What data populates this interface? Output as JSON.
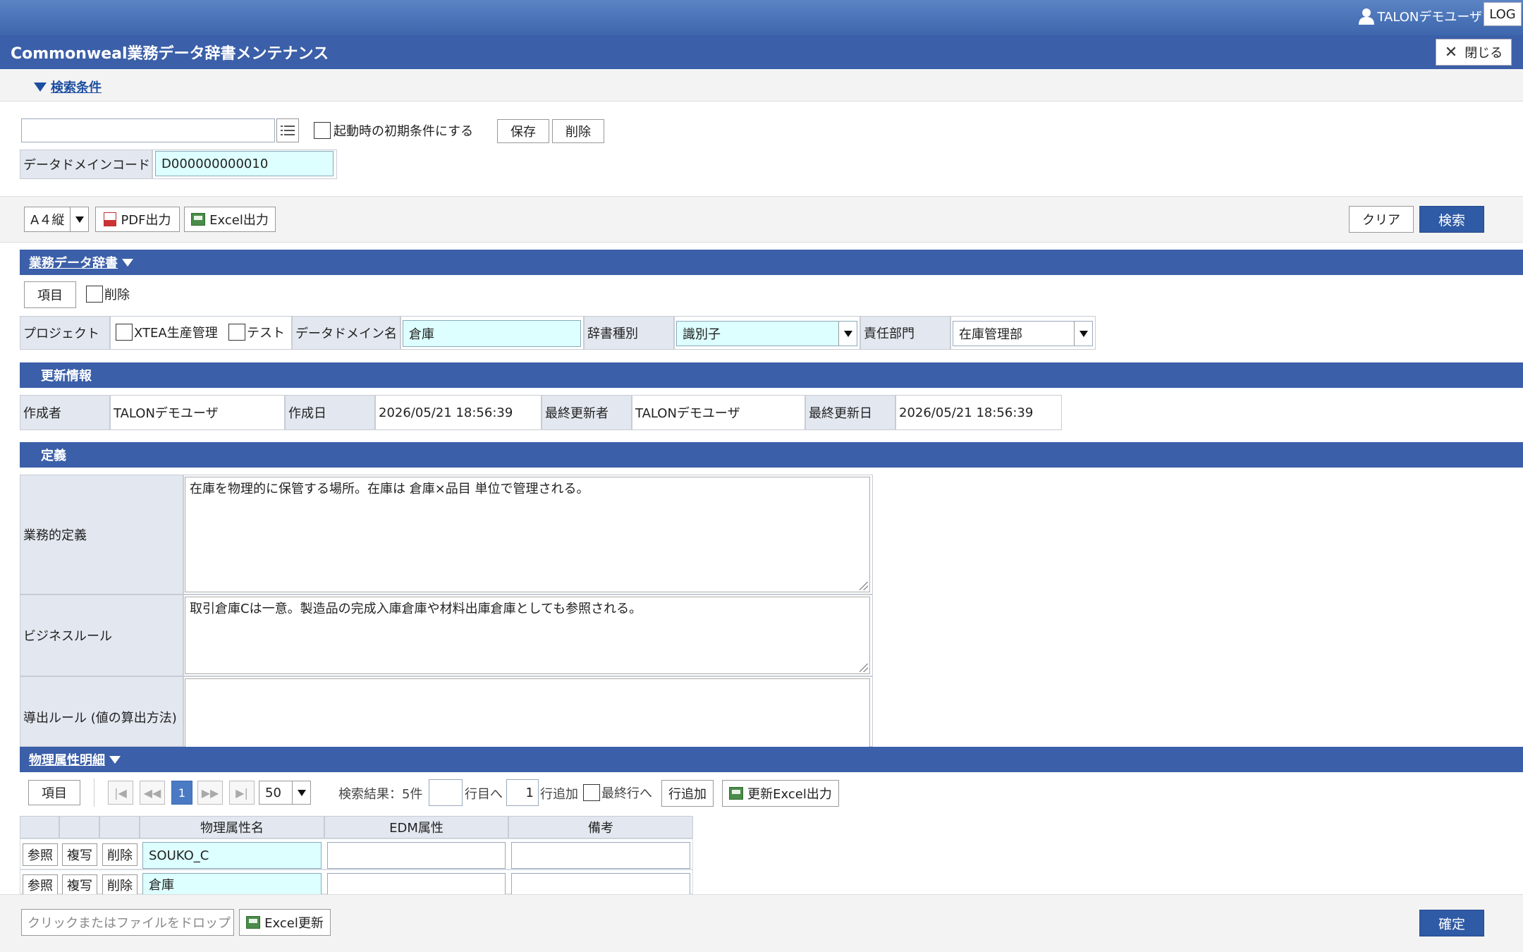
{
  "header": {
    "user": "TALONデモユーザ",
    "log_button": "LOG"
  },
  "title": "Commonweal業務データ辞書メンテナンス",
  "close_button": "閉じる",
  "search": {
    "toggle_label": "検索条件",
    "condition_name_value": "",
    "initial_condition_label": "起動時の初期条件にする",
    "save_button": "保存",
    "delete_button": "削除",
    "domain_code_label": "データドメインコード",
    "domain_code_value": "D000000000010"
  },
  "toolbar": {
    "paper_size": "A４縦",
    "pdf_button": "PDF出力",
    "excel_button": "Excel出力",
    "clear_button": "クリア",
    "search_button": "検索"
  },
  "dictionary": {
    "section_title": "業務データ辞書",
    "items_button": "項目",
    "delete_check_label": "削除",
    "project_label": "プロジェクト",
    "project_options": [
      "XTEA生産管理",
      "テスト"
    ],
    "domain_name_label": "データドメイン名",
    "domain_name_value": "倉庫",
    "dict_type_label": "辞書種別",
    "dict_type_value": "識別子",
    "dept_label": "責任部門",
    "dept_value": "在庫管理部"
  },
  "update_info": {
    "section_title": "更新情報",
    "creator_label": "作成者",
    "creator_value": "TALONデモユーザ",
    "created_label": "作成日",
    "created_value": "2026/05/21 18:56:39",
    "updater_label": "最終更新者",
    "updater_value": "TALONデモユーザ",
    "updated_label": "最終更新日",
    "updated_value": "2026/05/21 18:56:39"
  },
  "definition": {
    "section_title": "定義",
    "business_def_label": "業務的定義",
    "business_def_value": "在庫を物理的に保管する場所。在庫は 倉庫×品目 単位で管理される。",
    "business_rule_label": "ビジネスルール",
    "business_rule_value": "取引倉庫Cは一意。製造品の完成入庫倉庫や材料出庫倉庫としても参照される。",
    "derivation_label": "導出ルール (値の算出方法)",
    "derivation_value": ""
  },
  "physical": {
    "section_title": "物理属性明細",
    "items_button": "項目",
    "page_current": "1",
    "page_size": "50",
    "result_text": "検索結果：5件",
    "goto_row_suffix": "行目へ",
    "add_row_count": "1",
    "add_row_suffix": "行追加",
    "last_row_label": "最終行へ",
    "add_row_button": "行追加",
    "excel_update_button": "更新Excel出力",
    "columns": [
      "物理属性名",
      "EDM属性",
      "備考"
    ],
    "row_buttons": [
      "参照",
      "複写",
      "削除"
    ],
    "rows": [
      {
        "name": "SOUKO_C",
        "edm": "",
        "note": ""
      },
      {
        "name": "倉庫",
        "edm": "",
        "note": ""
      }
    ]
  },
  "footer": {
    "file_drop_placeholder": "クリックまたはファイルをドロップ",
    "excel_update_button": "Excel更新",
    "confirm_button": "確定"
  }
}
